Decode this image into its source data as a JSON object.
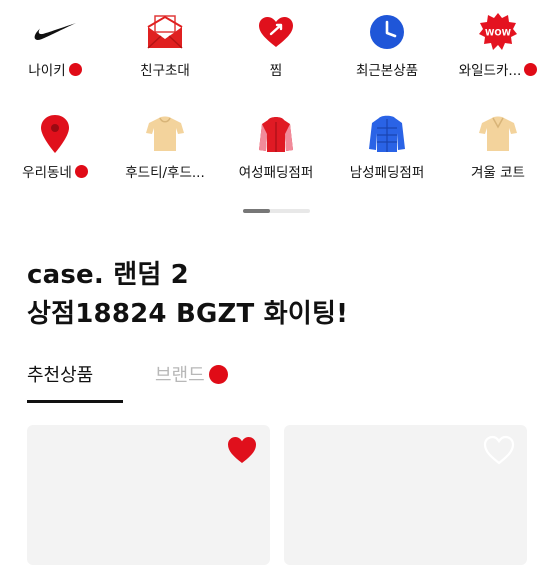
{
  "categories": [
    {
      "label": "나이키",
      "icon": "nike-swoosh-icon",
      "dot": true
    },
    {
      "label": "친구초대",
      "icon": "envelope-icon",
      "dot": false
    },
    {
      "label": "찜",
      "icon": "heart-arrow-icon",
      "dot": false
    },
    {
      "label": "최근본상품",
      "icon": "clock-icon",
      "dot": false
    },
    {
      "label": "와일드카...",
      "icon": "wow-badge-icon",
      "dot": true
    },
    {
      "label": "우리동네",
      "icon": "location-pin-icon",
      "dot": true
    },
    {
      "label": "후드티/후드...",
      "icon": "hoodie-beige-icon",
      "dot": false
    },
    {
      "label": "여성패딩점퍼",
      "icon": "padding-red-icon",
      "dot": false
    },
    {
      "label": "남성패딩점퍼",
      "icon": "padding-blue-icon",
      "dot": false
    },
    {
      "label": "겨울 코트",
      "icon": "coat-beige-icon",
      "dot": false
    }
  ],
  "indicator": {
    "position": 1,
    "total": 3
  },
  "title": {
    "line1": "case. 랜덤 2",
    "line2": "상점18824 BGZT 화이팅!"
  },
  "tabs": [
    {
      "label": "추천상품",
      "active": true
    },
    {
      "label": "브랜드",
      "active": false,
      "dot": true
    }
  ],
  "products": [
    {
      "liked": true
    },
    {
      "liked": false
    }
  ],
  "colors": {
    "accent_red": "#e00b17",
    "text": "#111111",
    "muted": "#b8b8b8",
    "card_bg": "#f3f3f3"
  }
}
